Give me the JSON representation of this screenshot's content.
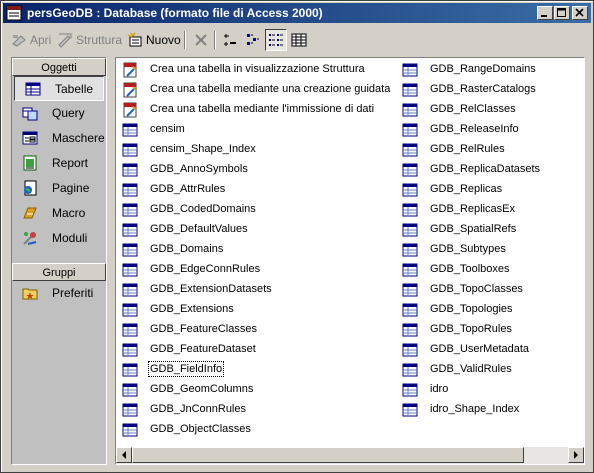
{
  "window": {
    "title": "persGeoDB : Database (formato file di Access 2000)",
    "icon": "database-window-icon",
    "controls": [
      "minimize",
      "maximize",
      "close"
    ]
  },
  "toolbar": {
    "open_label": "Apri",
    "design_label": "Struttura",
    "new_label": "Nuovo",
    "delete_icon": "delete-x-icon",
    "view_icons": [
      "large-icons-view",
      "small-icons-view",
      "list-view",
      "details-view"
    ],
    "active_view": "list-view"
  },
  "sidebar": {
    "objects_header": "Oggetti",
    "items": [
      {
        "label": "Tabelle",
        "icon": "table-icon",
        "selected": true
      },
      {
        "label": "Query",
        "icon": "query-icon"
      },
      {
        "label": "Maschere",
        "icon": "form-icon"
      },
      {
        "label": "Report",
        "icon": "report-icon"
      },
      {
        "label": "Pagine",
        "icon": "page-icon"
      },
      {
        "label": "Macro",
        "icon": "macro-icon"
      },
      {
        "label": "Moduli",
        "icon": "module-icon"
      }
    ],
    "groups_header": "Gruppi",
    "groups": [
      {
        "label": "Preferiti",
        "icon": "favorites-folder-icon"
      }
    ]
  },
  "list": {
    "column1": [
      {
        "label": "Crea una tabella in visualizzazione Struttura",
        "icon": "create-wizard-icon"
      },
      {
        "label": "Crea una tabella mediante una creazione guidata",
        "icon": "create-wizard-icon"
      },
      {
        "label": "Crea una tabella mediante l'immissione di dati",
        "icon": "create-wizard-icon"
      },
      {
        "label": "censim",
        "icon": "table-icon"
      },
      {
        "label": "censim_Shape_Index",
        "icon": "table-icon"
      },
      {
        "label": "GDB_AnnoSymbols",
        "icon": "table-icon"
      },
      {
        "label": "GDB_AttrRules",
        "icon": "table-icon"
      },
      {
        "label": "GDB_CodedDomains",
        "icon": "table-icon"
      },
      {
        "label": "GDB_DefaultValues",
        "icon": "table-icon"
      },
      {
        "label": "GDB_Domains",
        "icon": "table-icon"
      },
      {
        "label": "GDB_EdgeConnRules",
        "icon": "table-icon"
      },
      {
        "label": "GDB_ExtensionDatasets",
        "icon": "table-icon"
      },
      {
        "label": "GDB_Extensions",
        "icon": "table-icon"
      },
      {
        "label": "GDB_FeatureClasses",
        "icon": "table-icon"
      },
      {
        "label": "GDB_FeatureDataset",
        "icon": "table-icon"
      },
      {
        "label": "GDB_FieldInfo",
        "icon": "table-icon",
        "focused": true
      },
      {
        "label": "GDB_GeomColumns",
        "icon": "table-icon"
      },
      {
        "label": "GDB_JnConnRules",
        "icon": "table-icon"
      },
      {
        "label": "GDB_ObjectClasses",
        "icon": "table-icon"
      }
    ],
    "column2": [
      {
        "label": "GDB_RangeDomains",
        "icon": "table-icon"
      },
      {
        "label": "GDB_RasterCatalogs",
        "icon": "table-icon"
      },
      {
        "label": "GDB_RelClasses",
        "icon": "table-icon"
      },
      {
        "label": "GDB_ReleaseInfo",
        "icon": "table-icon"
      },
      {
        "label": "GDB_RelRules",
        "icon": "table-icon"
      },
      {
        "label": "GDB_ReplicaDatasets",
        "icon": "table-icon"
      },
      {
        "label": "GDB_Replicas",
        "icon": "table-icon"
      },
      {
        "label": "GDB_ReplicasEx",
        "icon": "table-icon"
      },
      {
        "label": "GDB_SpatialRefs",
        "icon": "table-icon"
      },
      {
        "label": "GDB_Subtypes",
        "icon": "table-icon"
      },
      {
        "label": "GDB_Toolboxes",
        "icon": "table-icon"
      },
      {
        "label": "GDB_TopoClasses",
        "icon": "table-icon"
      },
      {
        "label": "GDB_Topologies",
        "icon": "table-icon"
      },
      {
        "label": "GDB_TopoRules",
        "icon": "table-icon"
      },
      {
        "label": "GDB_UserMetadata",
        "icon": "table-icon"
      },
      {
        "label": "GDB_ValidRules",
        "icon": "table-icon"
      },
      {
        "label": "idro",
        "icon": "table-icon"
      },
      {
        "label": "idro_Shape_Index",
        "icon": "table-icon"
      }
    ]
  },
  "colors": {
    "titlebar_start": "#0a246a",
    "titlebar_end": "#3a6ea5",
    "face": "#d4d0c8",
    "list_bg": "#ffffff"
  }
}
